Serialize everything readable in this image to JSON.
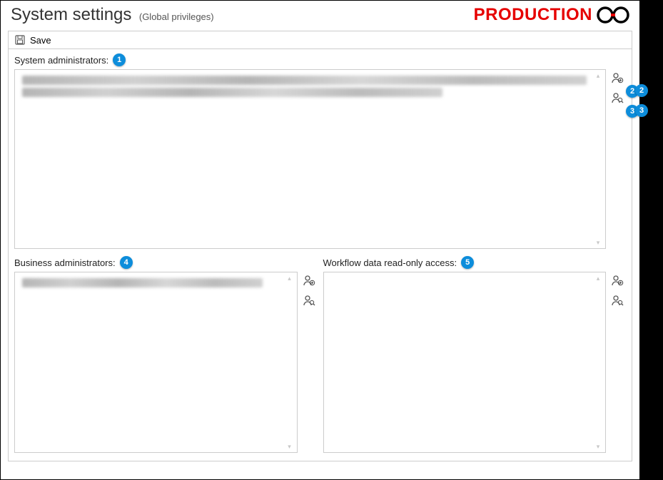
{
  "header": {
    "title": "System settings",
    "subtitle": "(Global privileges)",
    "environment": "PRODUCTION"
  },
  "toolbar": {
    "save_label": "Save"
  },
  "sections": {
    "system_admins": {
      "label": "System administrators:",
      "badge": "1"
    },
    "business_admins": {
      "label": "Business administrators:",
      "badge": "4"
    },
    "workflow_readonly": {
      "label": "Workflow data read-only access:",
      "badge": "5"
    }
  },
  "badges": {
    "add_user_top": "2",
    "search_user_top": "3"
  },
  "icons": {
    "add_user": "user-add-icon",
    "search_user": "user-search-icon",
    "save": "save-icon"
  }
}
